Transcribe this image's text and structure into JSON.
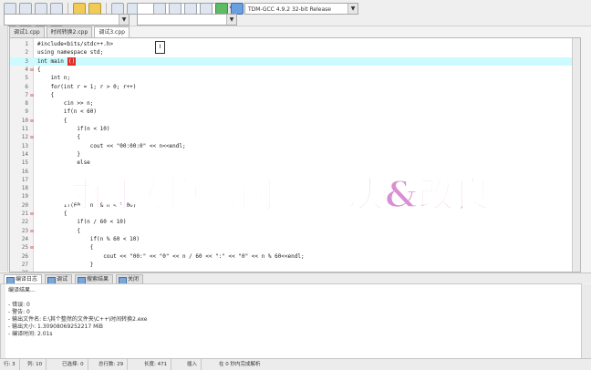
{
  "toolbar": {
    "compiler_select": "TDM-GCC 4.9.2 32-bit Release",
    "second_select": ""
  },
  "editor": {
    "tabs": [
      "调试1.cpp",
      "时间转换2.cpp",
      "调试3.cpp"
    ],
    "lines": [
      {
        "n": "1",
        "text": "#include<bits/stdc++.h>"
      },
      {
        "n": "2",
        "text": "using namespace std;"
      },
      {
        "n": "3",
        "text": "int main"
      },
      {
        "n": "4",
        "text": "{"
      },
      {
        "n": "5",
        "text": "    int n;"
      },
      {
        "n": "6",
        "text": "    for(int r = 1; r > 0; r++)"
      },
      {
        "n": "7",
        "text": "    {"
      },
      {
        "n": "8",
        "text": "        cin >> n;"
      },
      {
        "n": "9",
        "text": "        if(n < 60)"
      },
      {
        "n": "10",
        "text": "        {"
      },
      {
        "n": "11",
        "text": "            if(n < 10)"
      },
      {
        "n": "12",
        "text": "            {"
      },
      {
        "n": "13",
        "text": "                cout << \"00:00:0\" << n<<endl;"
      },
      {
        "n": "14",
        "text": "            }"
      },
      {
        "n": "15",
        "text": "            else"
      },
      {
        "n": "16",
        "text": ""
      },
      {
        "n": "17",
        "text": ""
      },
      {
        "n": "18",
        "text": ""
      },
      {
        "n": "19",
        "text": ""
      },
      {
        "n": "20",
        "text": "        if(60 < n && n < 3600)"
      },
      {
        "n": "21",
        "text": "        {"
      },
      {
        "n": "22",
        "text": "            if(n / 60 < 10)"
      },
      {
        "n": "23",
        "text": "            {"
      },
      {
        "n": "24",
        "text": "                if(n % 60 < 10)"
      },
      {
        "n": "25",
        "text": "                {"
      },
      {
        "n": "26",
        "text": "                    cout << \"00:\" << \"0\" << n / 60 << \":\" << \"0\" << n % 60<<endl;"
      },
      {
        "n": "27",
        "text": "                }"
      },
      {
        "n": "28",
        "text": ""
      }
    ]
  },
  "overlay_title": "时间转换器问题解决&改良",
  "bottom_tabs": [
    "编译日志",
    "调试",
    "搜索结果",
    "关闭"
  ],
  "output": {
    "heading": "编译结果...",
    "lines": [
      "- 错误: 0",
      "- 警告: 0",
      "- 输出文件名: E:\\其个整然的文件夹\\C++\\时间转换2.exe",
      "- 输出大小: 1.30908069252217 MiB",
      "- 编译时间: 2.01s"
    ]
  },
  "status": {
    "row": "行:",
    "row_val": "3",
    "col": "列:",
    "col_val": "10",
    "selected": "已选择:",
    "selected_val": "0",
    "total_lines": "总行数:",
    "total_lines_val": "29",
    "length": "长度:",
    "length_val": "471",
    "insert": "插入",
    "parse_msg": "在 0 秒内完成解析"
  }
}
